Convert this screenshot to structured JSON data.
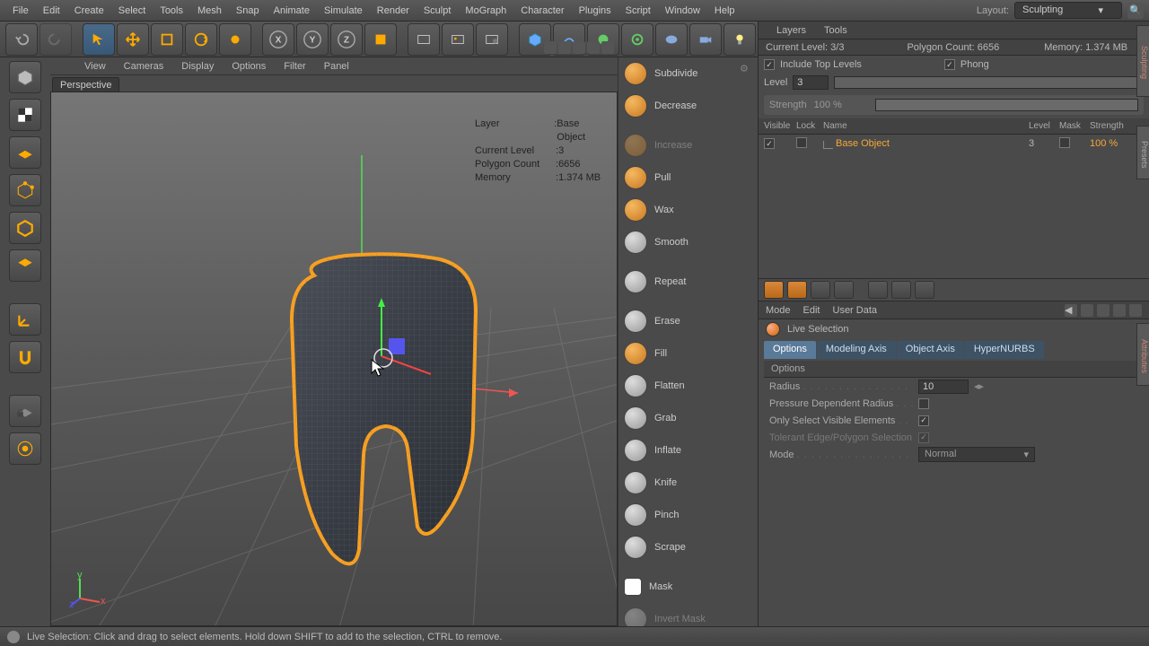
{
  "menu": [
    "File",
    "Edit",
    "Create",
    "Select",
    "Tools",
    "Mesh",
    "Snap",
    "Animate",
    "Simulate",
    "Render",
    "Sculpt",
    "MoGraph",
    "Character",
    "Plugins",
    "Script",
    "Window",
    "Help"
  ],
  "layout": {
    "label": "Layout:",
    "value": "Sculpting"
  },
  "viewport": {
    "menu": [
      "View",
      "Cameras",
      "Display",
      "Options",
      "Filter",
      "Panel"
    ],
    "title": "Perspective",
    "overlay": {
      "layer_l": "Layer",
      "layer_v": "Base Object",
      "level_l": "Current Level",
      "level_v": "3",
      "poly_l": "Polygon Count",
      "poly_v": "6656",
      "mem_l": "Memory",
      "mem_v": "1.374 MB"
    },
    "axis": {
      "x": "x",
      "y": "y",
      "z": "z"
    }
  },
  "sculpt_tools": [
    {
      "label": "Subdivide",
      "gear": true,
      "gray": false
    },
    {
      "label": "Decrease",
      "gray": false
    },
    {
      "label": "Increase",
      "gray": false,
      "disabled": true
    },
    {
      "label": "Pull",
      "gray": false
    },
    {
      "label": "Wax",
      "gray": false
    },
    {
      "label": "Smooth",
      "gray": true
    },
    {
      "label": "Repeat",
      "gray": true
    },
    {
      "label": "Erase",
      "gray": true
    },
    {
      "label": "Fill",
      "gray": false
    },
    {
      "label": "Flatten",
      "gray": true
    },
    {
      "label": "Grab",
      "gray": true
    },
    {
      "label": "Inflate",
      "gray": true
    },
    {
      "label": "Knife",
      "gray": true
    },
    {
      "label": "Pinch",
      "gray": true
    },
    {
      "label": "Scrape",
      "gray": true
    },
    {
      "label": "Mask",
      "sq": true
    },
    {
      "label": "Invert Mask",
      "gray": true,
      "disabled": true
    }
  ],
  "layers_panel": {
    "tabs": [
      "Layers",
      "Tools"
    ],
    "stats": {
      "level_l": "Current Level:",
      "level_v": "3/3",
      "poly_l": "Polygon Count:",
      "poly_v": "6656",
      "mem_l": "Memory:",
      "mem_v": "1.374 MB"
    },
    "include_top": "Include Top Levels",
    "phong": "Phong",
    "level_l": "Level",
    "level_v": "3",
    "strength_l": "Strength",
    "strength_v": "100 %",
    "headers": {
      "vis": "Visible",
      "lock": "Lock",
      "name": "Name",
      "lvl": "Level",
      "mask": "Mask",
      "str": "Strength"
    },
    "row": {
      "name": "Base Object",
      "lvl": "3",
      "str": "100 %"
    }
  },
  "attr": {
    "tabs": [
      "Mode",
      "Edit",
      "User Data"
    ],
    "tool": "Live Selection",
    "subtabs": [
      "Options",
      "Modeling Axis",
      "Object Axis",
      "HyperNURBS"
    ],
    "section": "Options",
    "radius_l": "Radius",
    "radius_v": "10",
    "pressure": "Pressure Dependent Radius",
    "visible_only": "Only Select Visible Elements",
    "tolerant": "Tolerant Edge/Polygon Selection",
    "mode_l": "Mode",
    "mode_v": "Normal"
  },
  "status": "Live Selection: Click and drag to select elements. Hold down SHIFT to add to the selection, CTRL to remove.",
  "vtabs": [
    "Sculpting",
    "Presets",
    "Attributes"
  ]
}
